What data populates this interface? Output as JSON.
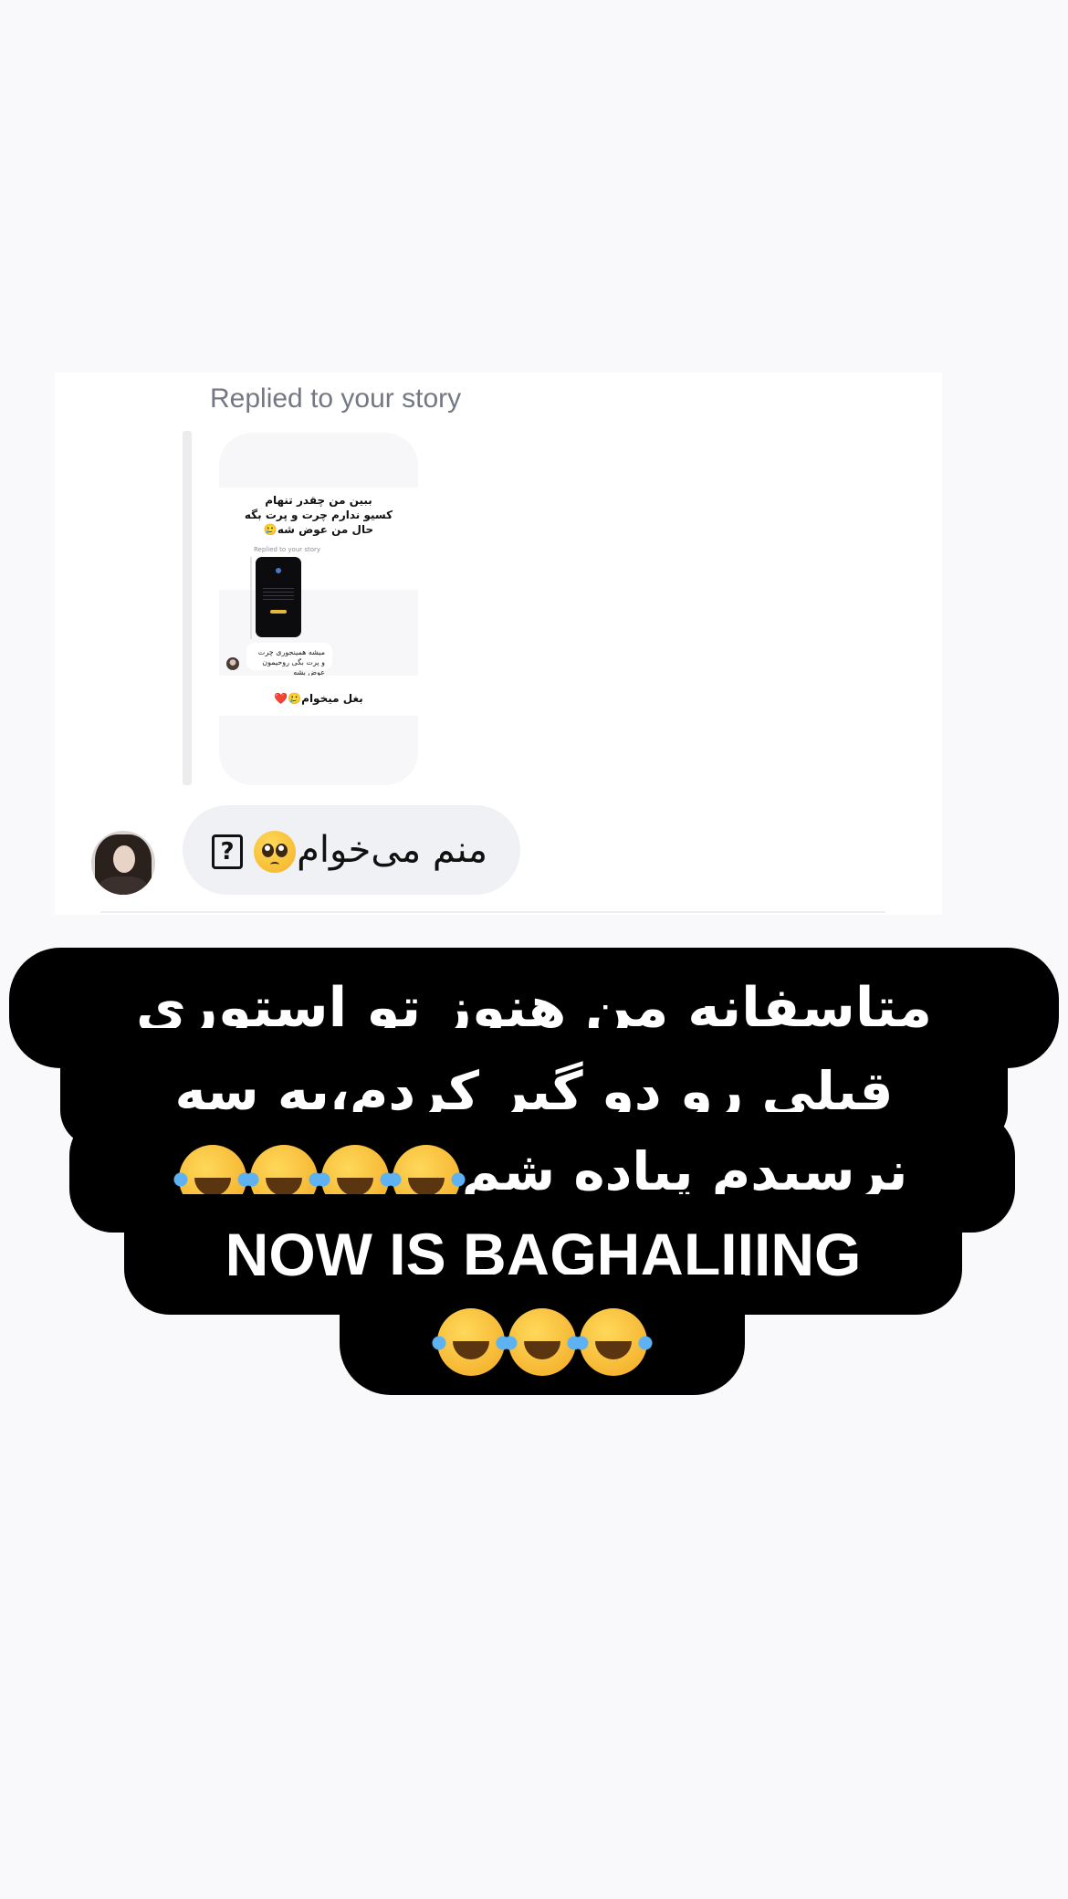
{
  "dm_card": {
    "replied_label": "Replied to your story",
    "story_preview": {
      "text": "ببین من چقدر تنهام\nکسیو ندارم چرت و پرت بگه\nحال من عوض شه🥲",
      "sub_label": "Replied to your story",
      "mini_reply": "میشه همینجوری چرت و پرت بگی روحیمون عوض بشه",
      "bottom_text": "بغل میخوام🥲❤️"
    },
    "reply_message": {
      "text": "منم می‌خوام",
      "icons": [
        "pleading-face-emoji",
        "unknown-character-box-icon"
      ]
    },
    "avatar": "user-avatar"
  },
  "caption": {
    "line1": "متاسفانه من هنوز تو استوری",
    "line2": "قبلی رو دو گیر کردم،به سه",
    "line3": "نرسیدم پیاده شم",
    "line3_emoji_count": 4,
    "line4": "NOW IS BAGHALIIING",
    "line5_emoji_count": 3,
    "emoji": "face-with-tears-of-joy"
  },
  "colors": {
    "background": "#f9f9fb",
    "card": "#ffffff",
    "bubble": "#f0f1f4",
    "caption_bg": "#000000",
    "caption_text": "#ffffff",
    "muted_text": "#737884"
  }
}
